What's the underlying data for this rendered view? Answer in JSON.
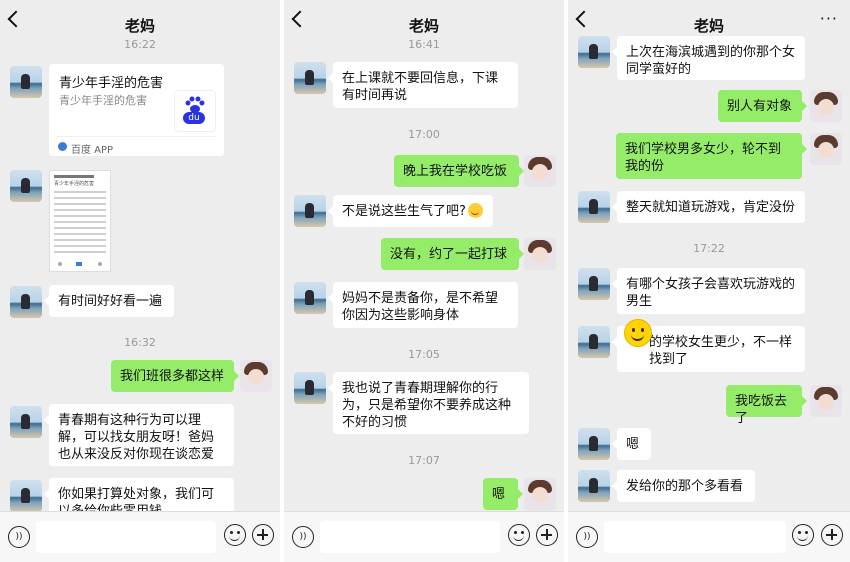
{
  "panels": [
    {
      "title": "老妈",
      "ts": [
        "16:22",
        "16:32"
      ],
      "card": {
        "title": "青少年手淫的危害",
        "subtitle": "青少年手淫的危害",
        "source": "百度 APP",
        "logo_text": "du"
      },
      "image_caption": "青少年手淫的危害",
      "msgs": [
        "有时间好好看一遍",
        "我们班很多都这样",
        "青春期有这种行为可以理解，可以找女朋友呀！爸妈也从来没反对你现在谈恋爱",
        "你如果打算处对象，我们可以多给你些零用钱"
      ]
    },
    {
      "title": "老妈",
      "ts": [
        "16:41",
        "17:00",
        "17:05",
        "17:07"
      ],
      "msgs": [
        "在上课就不要回信息，下课有时间再说",
        "晚上我在学校吃饭",
        "不是说这些生气了吧?",
        "没有，约了一起打球",
        "妈妈不是责备你，是不希望你因为这些影响身体",
        "我也说了青春期理解你的行为，只是希望你不要养成这种不好的习惯",
        "嗯"
      ]
    },
    {
      "title": "老妈",
      "more": "···",
      "ts": [
        "17:22"
      ],
      "msgs": [
        "上次在海滨城遇到的你那个女同学蛮好的",
        "别人有对象",
        "我们学校男多女少，轮不到我的份",
        "整天就知道玩游戏，肯定没份",
        "有哪个女孩子会喜欢玩游戏的男生",
        "的学校女生更少，不一样找到了",
        "我吃饭去了",
        "嗯",
        "发给你的那个多看看"
      ]
    }
  ],
  "colors": {
    "bg": "#ededed",
    "sent": "#95ec69",
    "recv": "#ffffff"
  },
  "icons": [
    "back-icon",
    "voice-icon",
    "emoji-icon",
    "plus-icon",
    "more-icon"
  ]
}
